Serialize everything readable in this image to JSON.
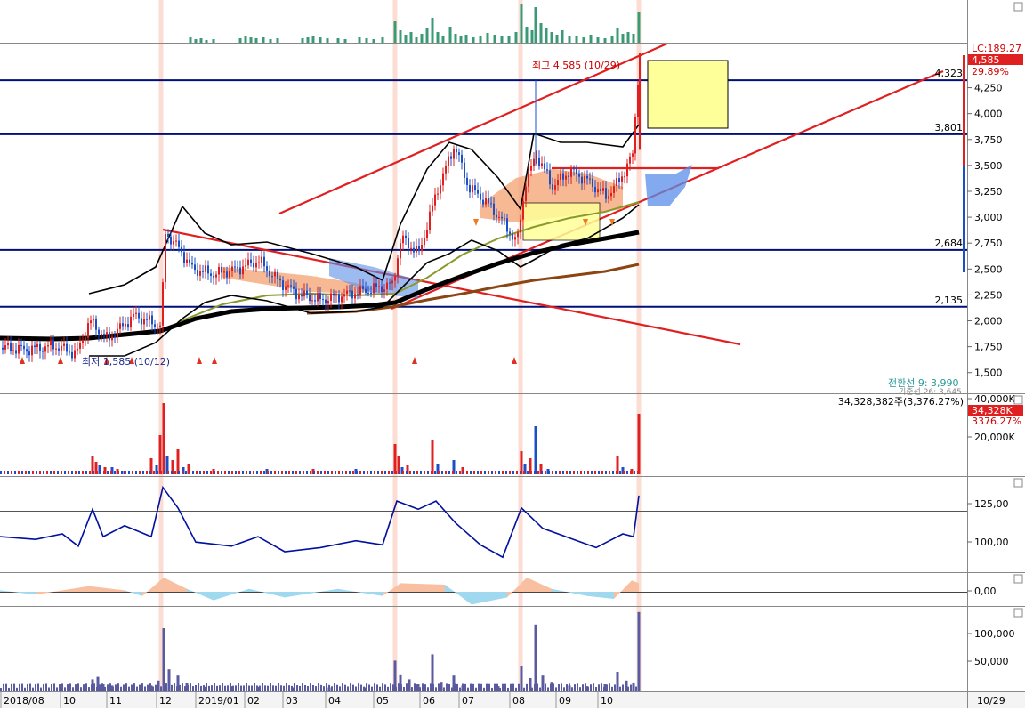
{
  "colors": {
    "up": "#e02020",
    "down": "#1a4fc8",
    "level_line": "#00107a",
    "trend_line": "#e02020",
    "overlay_volume": "#3a9a76",
    "ma_black": "#000000",
    "ma_brown": "#8b4513",
    "ma_olive": "#8a9a2a",
    "cloud_orange": "#f4a070",
    "cloud_blue": "#5a8ee8",
    "obv_line": "#0010a0",
    "osc_pos": "#f8c0a0",
    "osc_neg": "#a0d8f0",
    "vol2": "#5a5aa0",
    "highlight_band": "#fbd5c8",
    "note_box": "#ffff99"
  },
  "price_panel": {
    "axis_ticks": [
      "4,250",
      "4,000",
      "3,750",
      "3,500",
      "3,250",
      "3,000",
      "2,750",
      "2,500",
      "2,250",
      "2,000",
      "1,750",
      "1,500"
    ],
    "lc_label": "LC:189.27",
    "current_price": "4,585",
    "current_change": "29.89%",
    "high_annotation": "최고 4,585 (10/29)",
    "low_annotation": "최저 1,585 (10/12)",
    "levels": [
      {
        "value": 4323,
        "label": "4,323"
      },
      {
        "value": 3801,
        "label": "3,801"
      },
      {
        "value": 2684,
        "label": "2,684"
      },
      {
        "value": 2135,
        "label": "2,135"
      }
    ],
    "indicator_line1": "전환선 9: 3,990",
    "indicator_line2": "기준선 26: 3,645"
  },
  "volume_panel": {
    "info": "34,328,382주(3,376.27%)",
    "axis_ticks": [
      "40,000K",
      "20,000K"
    ],
    "current_value": "34,328K",
    "current_pct": "3376.27%"
  },
  "obv_panel": {
    "axis_ticks": [
      "125,00",
      "100,00"
    ]
  },
  "osc_panel": {
    "axis_ticks": [
      "0,00"
    ]
  },
  "bottom_panel": {
    "axis_ticks": [
      "100,000",
      "50,000"
    ]
  },
  "x_axis": {
    "labels": [
      "2018/08",
      "10",
      "11",
      "12",
      "2019/01",
      "02",
      "03",
      "04",
      "05",
      "06",
      "07",
      "08",
      "09",
      "10"
    ],
    "cursor_label": "10/29"
  },
  "chart_data": {
    "type": "candlestick",
    "ylim": [
      1300,
      4650
    ],
    "price_path": [
      {
        "x": 0,
        "y": 1740
      },
      {
        "x": 30,
        "y": 1720
      },
      {
        "x": 60,
        "y": 1760
      },
      {
        "x": 85,
        "y": 1680
      },
      {
        "x": 100,
        "y": 2000
      },
      {
        "x": 120,
        "y": 1820
      },
      {
        "x": 150,
        "y": 2050
      },
      {
        "x": 180,
        "y": 1950
      },
      {
        "x": 185,
        "y": 2850
      },
      {
        "x": 200,
        "y": 2700
      },
      {
        "x": 215,
        "y": 2500
      },
      {
        "x": 240,
        "y": 2450
      },
      {
        "x": 265,
        "y": 2500
      },
      {
        "x": 290,
        "y": 2580
      },
      {
        "x": 310,
        "y": 2400
      },
      {
        "x": 335,
        "y": 2250
      },
      {
        "x": 360,
        "y": 2200
      },
      {
        "x": 385,
        "y": 2250
      },
      {
        "x": 415,
        "y": 2300
      },
      {
        "x": 440,
        "y": 2350
      },
      {
        "x": 450,
        "y": 2800
      },
      {
        "x": 470,
        "y": 2650
      },
      {
        "x": 490,
        "y": 3250
      },
      {
        "x": 510,
        "y": 3700
      },
      {
        "x": 525,
        "y": 3300
      },
      {
        "x": 545,
        "y": 3150
      },
      {
        "x": 565,
        "y": 2950
      },
      {
        "x": 580,
        "y": 2750
      },
      {
        "x": 590,
        "y": 3350
      },
      {
        "x": 602,
        "y": 3600
      },
      {
        "x": 620,
        "y": 3300
      },
      {
        "x": 640,
        "y": 3450
      },
      {
        "x": 660,
        "y": 3350
      },
      {
        "x": 680,
        "y": 3200
      },
      {
        "x": 695,
        "y": 3350
      },
      {
        "x": 710,
        "y": 3600
      },
      {
        "x": 718,
        "y": 4585
      }
    ],
    "highlight_columns_x": [
      181,
      444,
      585,
      718
    ],
    "pivot_x_labels_x": [
      3,
      70,
      122,
      178,
      222,
      277,
      320,
      368,
      422,
      474,
      518,
      575,
      627,
      674
    ],
    "overlay_volume": [
      {
        "x": 214,
        "v": 6
      },
      {
        "x": 220,
        "v": 4
      },
      {
        "x": 226,
        "v": 5
      },
      {
        "x": 232,
        "v": 3
      },
      {
        "x": 240,
        "v": 4
      },
      {
        "x": 270,
        "v": 5
      },
      {
        "x": 276,
        "v": 7
      },
      {
        "x": 282,
        "v": 6
      },
      {
        "x": 288,
        "v": 5
      },
      {
        "x": 296,
        "v": 6
      },
      {
        "x": 304,
        "v": 4
      },
      {
        "x": 312,
        "v": 5
      },
      {
        "x": 340,
        "v": 5
      },
      {
        "x": 346,
        "v": 6
      },
      {
        "x": 352,
        "v": 7
      },
      {
        "x": 360,
        "v": 6
      },
      {
        "x": 368,
        "v": 5
      },
      {
        "x": 380,
        "v": 5
      },
      {
        "x": 388,
        "v": 4
      },
      {
        "x": 404,
        "v": 6
      },
      {
        "x": 412,
        "v": 5
      },
      {
        "x": 420,
        "v": 4
      },
      {
        "x": 430,
        "v": 6
      },
      {
        "x": 444,
        "v": 24
      },
      {
        "x": 450,
        "v": 14
      },
      {
        "x": 456,
        "v": 9
      },
      {
        "x": 462,
        "v": 12
      },
      {
        "x": 468,
        "v": 6
      },
      {
        "x": 474,
        "v": 10
      },
      {
        "x": 480,
        "v": 16
      },
      {
        "x": 486,
        "v": 28
      },
      {
        "x": 492,
        "v": 12
      },
      {
        "x": 498,
        "v": 8
      },
      {
        "x": 506,
        "v": 18
      },
      {
        "x": 512,
        "v": 10
      },
      {
        "x": 518,
        "v": 7
      },
      {
        "x": 524,
        "v": 9
      },
      {
        "x": 532,
        "v": 6
      },
      {
        "x": 540,
        "v": 8
      },
      {
        "x": 548,
        "v": 11
      },
      {
        "x": 556,
        "v": 9
      },
      {
        "x": 564,
        "v": 7
      },
      {
        "x": 572,
        "v": 8
      },
      {
        "x": 580,
        "v": 12
      },
      {
        "x": 586,
        "v": 44
      },
      {
        "x": 592,
        "v": 18
      },
      {
        "x": 598,
        "v": 14
      },
      {
        "x": 602,
        "v": 40
      },
      {
        "x": 608,
        "v": 22
      },
      {
        "x": 614,
        "v": 16
      },
      {
        "x": 620,
        "v": 12
      },
      {
        "x": 626,
        "v": 9
      },
      {
        "x": 632,
        "v": 14
      },
      {
        "x": 640,
        "v": 8
      },
      {
        "x": 648,
        "v": 7
      },
      {
        "x": 656,
        "v": 6
      },
      {
        "x": 664,
        "v": 9
      },
      {
        "x": 672,
        "v": 6
      },
      {
        "x": 680,
        "v": 5
      },
      {
        "x": 688,
        "v": 7
      },
      {
        "x": 694,
        "v": 16
      },
      {
        "x": 700,
        "v": 10
      },
      {
        "x": 706,
        "v": 12
      },
      {
        "x": 712,
        "v": 10
      },
      {
        "x": 718,
        "v": 34
      }
    ],
    "volume_bars": [
      {
        "x": 104,
        "v": 10,
        "up": true
      },
      {
        "x": 108,
        "v": 7,
        "up": true
      },
      {
        "x": 112,
        "v": 5,
        "up": false
      },
      {
        "x": 118,
        "v": 4,
        "up": true
      },
      {
        "x": 126,
        "v": 4,
        "up": false
      },
      {
        "x": 132,
        "v": 3,
        "up": true
      },
      {
        "x": 140,
        "v": 2,
        "up": false
      },
      {
        "x": 170,
        "v": 9,
        "up": true
      },
      {
        "x": 176,
        "v": 5,
        "up": false
      },
      {
        "x": 180,
        "v": 22,
        "up": true
      },
      {
        "x": 184,
        "v": 40,
        "up": true
      },
      {
        "x": 188,
        "v": 10,
        "up": false
      },
      {
        "x": 194,
        "v": 8,
        "up": true
      },
      {
        "x": 200,
        "v": 14,
        "up": true
      },
      {
        "x": 206,
        "v": 4,
        "up": false
      },
      {
        "x": 212,
        "v": 6,
        "up": true
      },
      {
        "x": 240,
        "v": 3,
        "up": true
      },
      {
        "x": 300,
        "v": 3,
        "up": false
      },
      {
        "x": 352,
        "v": 3,
        "up": true
      },
      {
        "x": 400,
        "v": 3,
        "up": false
      },
      {
        "x": 444,
        "v": 17,
        "up": true
      },
      {
        "x": 448,
        "v": 10,
        "up": true
      },
      {
        "x": 452,
        "v": 4,
        "up": false
      },
      {
        "x": 458,
        "v": 5,
        "up": true
      },
      {
        "x": 486,
        "v": 19,
        "up": true
      },
      {
        "x": 492,
        "v": 6,
        "up": false
      },
      {
        "x": 510,
        "v": 8,
        "up": false
      },
      {
        "x": 520,
        "v": 4,
        "up": true
      },
      {
        "x": 586,
        "v": 13,
        "up": true
      },
      {
        "x": 590,
        "v": 6,
        "up": false
      },
      {
        "x": 596,
        "v": 9,
        "up": true
      },
      {
        "x": 602,
        "v": 27,
        "up": false
      },
      {
        "x": 608,
        "v": 6,
        "up": true
      },
      {
        "x": 616,
        "v": 3,
        "up": false
      },
      {
        "x": 694,
        "v": 10,
        "up": true
      },
      {
        "x": 700,
        "v": 4,
        "up": false
      },
      {
        "x": 710,
        "v": 3,
        "up": true
      },
      {
        "x": 718,
        "v": 34,
        "up": true
      }
    ],
    "obv_path": [
      {
        "x": 0,
        "y": 104
      },
      {
        "x": 40,
        "y": 102
      },
      {
        "x": 70,
        "y": 106
      },
      {
        "x": 88,
        "y": 97
      },
      {
        "x": 104,
        "y": 124
      },
      {
        "x": 116,
        "y": 104
      },
      {
        "x": 140,
        "y": 112
      },
      {
        "x": 170,
        "y": 104
      },
      {
        "x": 183,
        "y": 140
      },
      {
        "x": 200,
        "y": 125
      },
      {
        "x": 220,
        "y": 100
      },
      {
        "x": 260,
        "y": 97
      },
      {
        "x": 290,
        "y": 104
      },
      {
        "x": 320,
        "y": 93
      },
      {
        "x": 360,
        "y": 96
      },
      {
        "x": 400,
        "y": 101
      },
      {
        "x": 430,
        "y": 98
      },
      {
        "x": 446,
        "y": 130
      },
      {
        "x": 470,
        "y": 124
      },
      {
        "x": 490,
        "y": 130
      },
      {
        "x": 512,
        "y": 114
      },
      {
        "x": 540,
        "y": 98
      },
      {
        "x": 565,
        "y": 89
      },
      {
        "x": 586,
        "y": 125
      },
      {
        "x": 610,
        "y": 110
      },
      {
        "x": 640,
        "y": 103
      },
      {
        "x": 670,
        "y": 96
      },
      {
        "x": 700,
        "y": 106
      },
      {
        "x": 712,
        "y": 104
      },
      {
        "x": 718,
        "y": 134
      }
    ],
    "osc_path": [
      {
        "x": 0,
        "y": 0.1
      },
      {
        "x": 40,
        "y": -0.2
      },
      {
        "x": 100,
        "y": 0.4
      },
      {
        "x": 140,
        "y": 0.1
      },
      {
        "x": 160,
        "y": -0.3
      },
      {
        "x": 184,
        "y": 1.0
      },
      {
        "x": 210,
        "y": 0.2
      },
      {
        "x": 240,
        "y": -0.6
      },
      {
        "x": 280,
        "y": 0.2
      },
      {
        "x": 320,
        "y": -0.4
      },
      {
        "x": 380,
        "y": 0.2
      },
      {
        "x": 430,
        "y": -0.3
      },
      {
        "x": 450,
        "y": 0.6
      },
      {
        "x": 500,
        "y": 0.5
      },
      {
        "x": 530,
        "y": -0.9
      },
      {
        "x": 570,
        "y": -0.4
      },
      {
        "x": 592,
        "y": 1.0
      },
      {
        "x": 620,
        "y": 0.2
      },
      {
        "x": 660,
        "y": -0.3
      },
      {
        "x": 690,
        "y": -0.5
      },
      {
        "x": 710,
        "y": 0.8
      },
      {
        "x": 718,
        "y": 0.6
      }
    ],
    "bottom_bars": [
      {
        "x": 104,
        "v": 18
      },
      {
        "x": 110,
        "v": 22
      },
      {
        "x": 116,
        "v": 10
      },
      {
        "x": 126,
        "v": 8
      },
      {
        "x": 140,
        "v": 6
      },
      {
        "x": 150,
        "v": 5
      },
      {
        "x": 170,
        "v": 8
      },
      {
        "x": 178,
        "v": 16
      },
      {
        "x": 184,
        "v": 100
      },
      {
        "x": 190,
        "v": 34
      },
      {
        "x": 200,
        "v": 24
      },
      {
        "x": 210,
        "v": 12
      },
      {
        "x": 230,
        "v": 6
      },
      {
        "x": 260,
        "v": 7
      },
      {
        "x": 290,
        "v": 6
      },
      {
        "x": 330,
        "v": 5
      },
      {
        "x": 370,
        "v": 5
      },
      {
        "x": 410,
        "v": 5
      },
      {
        "x": 444,
        "v": 48
      },
      {
        "x": 450,
        "v": 26
      },
      {
        "x": 460,
        "v": 18
      },
      {
        "x": 470,
        "v": 10
      },
      {
        "x": 486,
        "v": 58
      },
      {
        "x": 496,
        "v": 14
      },
      {
        "x": 510,
        "v": 24
      },
      {
        "x": 520,
        "v": 8
      },
      {
        "x": 540,
        "v": 8
      },
      {
        "x": 560,
        "v": 7
      },
      {
        "x": 586,
        "v": 40
      },
      {
        "x": 596,
        "v": 20
      },
      {
        "x": 602,
        "v": 106
      },
      {
        "x": 610,
        "v": 24
      },
      {
        "x": 620,
        "v": 14
      },
      {
        "x": 640,
        "v": 8
      },
      {
        "x": 660,
        "v": 7
      },
      {
        "x": 680,
        "v": 10
      },
      {
        "x": 694,
        "v": 30
      },
      {
        "x": 704,
        "v": 16
      },
      {
        "x": 712,
        "v": 12
      },
      {
        "x": 718,
        "v": 126
      }
    ]
  }
}
